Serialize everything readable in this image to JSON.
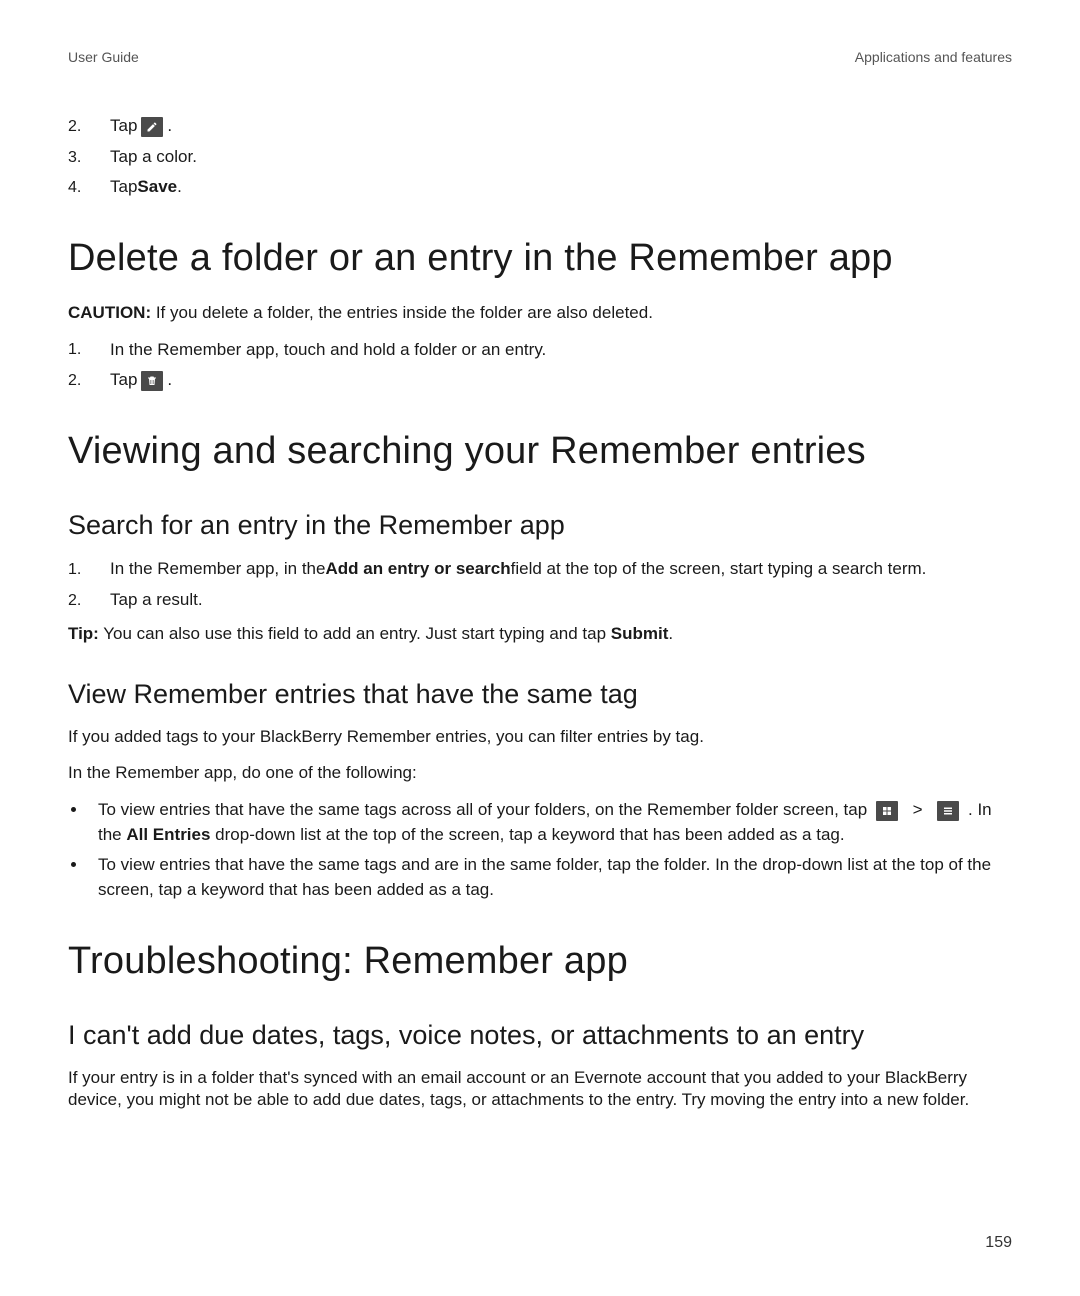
{
  "header": {
    "left": "User Guide",
    "right": "Applications and features"
  },
  "topList": [
    {
      "num": "2.",
      "pre": "Tap ",
      "icon": "edit-icon",
      "post": "."
    },
    {
      "num": "3.",
      "text": "Tap a color."
    },
    {
      "num": "4.",
      "pre": "Tap ",
      "bold": "Save",
      "post": "."
    }
  ],
  "section1": {
    "title": "Delete a folder or an entry in the Remember app",
    "caution_label": "CAUTION:",
    "caution_text": " If you delete a folder, the entries inside the folder are also deleted.",
    "steps": [
      {
        "num": "1.",
        "text": "In the Remember app, touch and hold a folder or an entry."
      },
      {
        "num": "2.",
        "pre": "Tap ",
        "icon": "delete-icon",
        "post": "."
      }
    ]
  },
  "section2": {
    "title": "Viewing and searching your Remember entries",
    "sub1": {
      "title": "Search for an entry in the Remember app",
      "steps": [
        {
          "num": "1.",
          "pre": "In the Remember app, in the ",
          "bold": "Add an entry or search",
          "post": " field at the top of the screen, start typing a search term."
        },
        {
          "num": "2.",
          "text": "Tap a result."
        }
      ],
      "tip_label": "Tip:",
      "tip_mid": " You can also use this field to add an entry. Just start typing and tap ",
      "tip_bold": "Submit",
      "tip_end": "."
    },
    "sub2": {
      "title": "View Remember entries that have the same tag",
      "p1": "If you added tags to your BlackBerry Remember entries, you can filter entries by tag.",
      "p2": "In the Remember app, do one of the following:",
      "bullets": {
        "b1_pre": "To view entries that have the same tags across all of your folders, on the Remember folder screen, tap ",
        "b1_sep": " > ",
        "b1_mid": ". In the ",
        "b1_bold": "All Entries",
        "b1_post": " drop-down list at the top of the screen, tap a keyword that has been added as a tag.",
        "b2": "To view entries that have the same tags and are in the same folder, tap the folder. In the drop-down list at the top of the screen, tap a keyword that has been added as a tag."
      }
    }
  },
  "section3": {
    "title": "Troubleshooting: Remember app",
    "sub1": {
      "title": "I can't add due dates, tags, voice notes, or attachments to an entry",
      "p": "If your entry is in a folder that's synced with an email account or an Evernote account that you added to your BlackBerry device, you might not be able to add due dates, tags, or attachments to the entry. Try moving the entry into a new folder."
    }
  },
  "page_number": "159"
}
